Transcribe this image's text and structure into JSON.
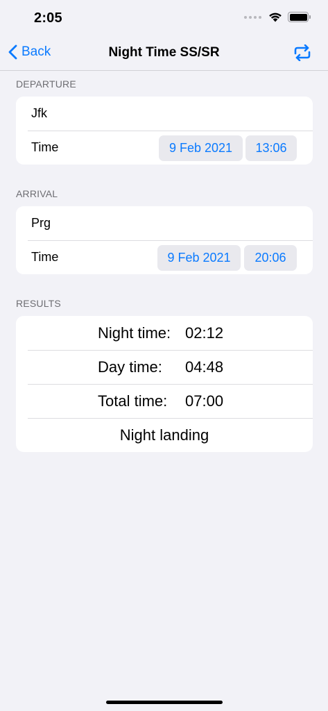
{
  "status_bar": {
    "time": "2:05"
  },
  "nav": {
    "back_label": "Back",
    "title": "Night Time SS/SR",
    "action_icon": "swap-icon",
    "accent": "#0a7aff"
  },
  "departure": {
    "header": "DEPARTURE",
    "location": "Jfk",
    "time_label": "Time",
    "date": "9 Feb 2021",
    "time": "13:06"
  },
  "arrival": {
    "header": "ARRIVAL",
    "location": "Prg",
    "time_label": "Time",
    "date": "9 Feb 2021",
    "time": "20:06"
  },
  "results": {
    "header": "RESULTS",
    "night_label": "Night time:",
    "night_value": "02:12",
    "day_label": "Day time:",
    "day_value": "04:48",
    "total_label": "Total time:",
    "total_value": "07:00",
    "landing": "Night landing"
  }
}
